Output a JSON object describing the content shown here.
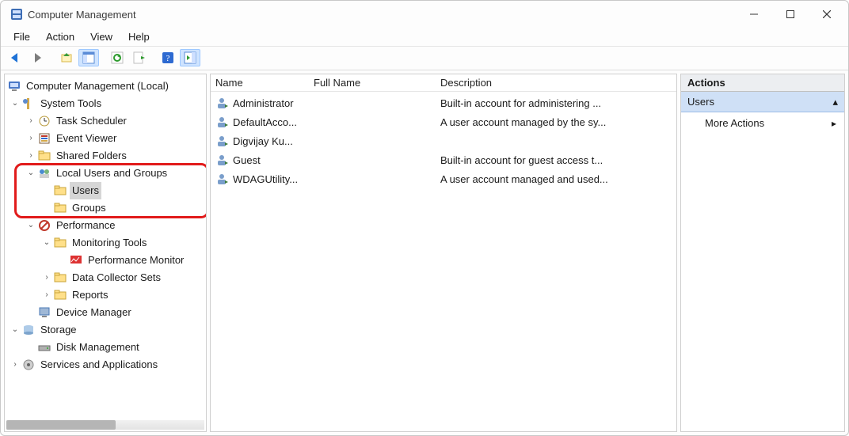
{
  "window": {
    "title": "Computer Management"
  },
  "menu": [
    "File",
    "Action",
    "View",
    "Help"
  ],
  "tree": {
    "root": "Computer Management (Local)",
    "system_tools": "System Tools",
    "task_scheduler": "Task Scheduler",
    "event_viewer": "Event Viewer",
    "shared_folders": "Shared Folders",
    "local_users_groups": "Local Users and Groups",
    "users": "Users",
    "groups": "Groups",
    "performance": "Performance",
    "monitoring_tools": "Monitoring Tools",
    "performance_monitor": "Performance Monitor",
    "data_collector_sets": "Data Collector Sets",
    "reports": "Reports",
    "device_manager": "Device Manager",
    "storage": "Storage",
    "disk_management": "Disk Management",
    "services_apps": "Services and Applications"
  },
  "columns": {
    "name": "Name",
    "full": "Full Name",
    "desc": "Description"
  },
  "users": [
    {
      "name": "Administrator",
      "full": "",
      "desc": "Built-in account for administering ..."
    },
    {
      "name": "DefaultAcco...",
      "full": "",
      "desc": "A user account managed by the sy..."
    },
    {
      "name": "Digvijay Ku...",
      "full": "",
      "desc": ""
    },
    {
      "name": "Guest",
      "full": "",
      "desc": "Built-in account for guest access t..."
    },
    {
      "name": "WDAGUtility...",
      "full": "",
      "desc": "A user account managed and used..."
    }
  ],
  "actions": {
    "header": "Actions",
    "section": "Users",
    "more": "More Actions"
  }
}
